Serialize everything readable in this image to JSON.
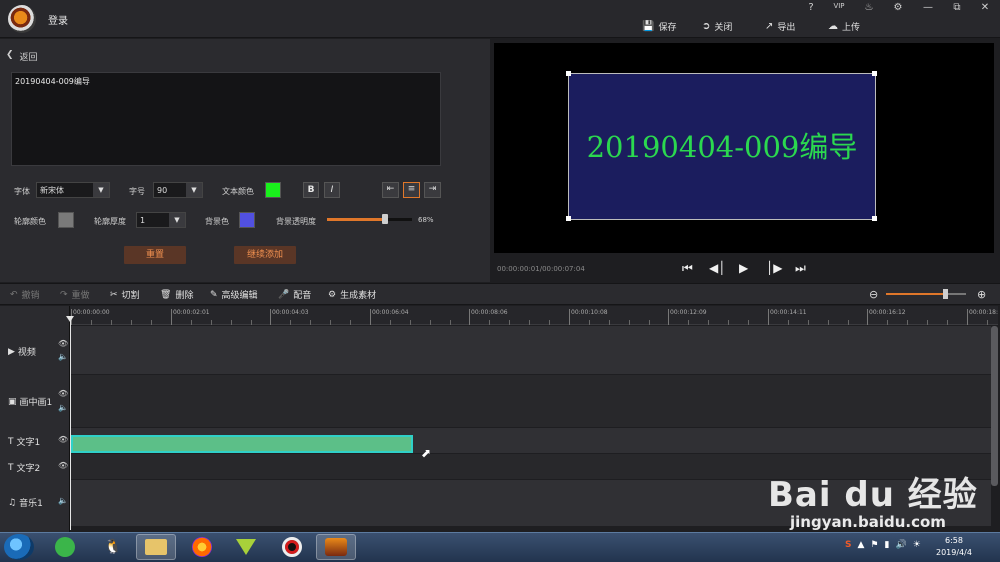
{
  "titlebar": {
    "login": "登录",
    "save": "保存",
    "close": "关闭",
    "export": "导出",
    "upload": "上传",
    "help": "?",
    "vip": "VIP"
  },
  "editor": {
    "back": "返回",
    "text_value": "20190404-009编导",
    "font_label": "字体",
    "font_value": "新宋体",
    "size_label": "字号",
    "size_value": "90",
    "text_color_label": "文本颜色",
    "text_color": "#19f01c",
    "bold": "B",
    "italic": "I",
    "outline_color_label": "轮廓颜色",
    "outline_color": "#7a7a7a",
    "outline_width_label": "轮廓厚度",
    "outline_width_value": "1",
    "bg_color_label": "背景色",
    "bg_color": "#5150e0",
    "bg_opacity_label": "背景透明度",
    "bg_opacity_value": "68%",
    "bg_opacity": 0.68,
    "reset": "重置",
    "continue_add": "继续添加"
  },
  "preview": {
    "text": "20190404-009编导",
    "timecode": "00:00:00:01/00:00:07:04"
  },
  "timeline_toolbar": {
    "undo": "撤销",
    "redo": "重做",
    "cut": "切割",
    "delete": "删除",
    "advanced_edit": "高级编辑",
    "dub": "配音",
    "generate": "生成素材"
  },
  "ruler": [
    "00:00:00:00",
    "00:00:02:01",
    "00:00:04:03",
    "00:00:06:04",
    "00:00:08:06",
    "00:00:10:08",
    "00:00:12:09",
    "00:00:14:11",
    "00:00:16:12",
    "00:00:18:"
  ],
  "tracks": {
    "video": "视频",
    "pip": "画中画1",
    "text1": "文字1",
    "text2": "文字2",
    "music": "音乐1"
  },
  "taskbar": {
    "time": "6:58",
    "date": "2019/4/4"
  },
  "watermark": {
    "logo": "Bai du 经验",
    "url": "jingyan.baidu.com"
  }
}
